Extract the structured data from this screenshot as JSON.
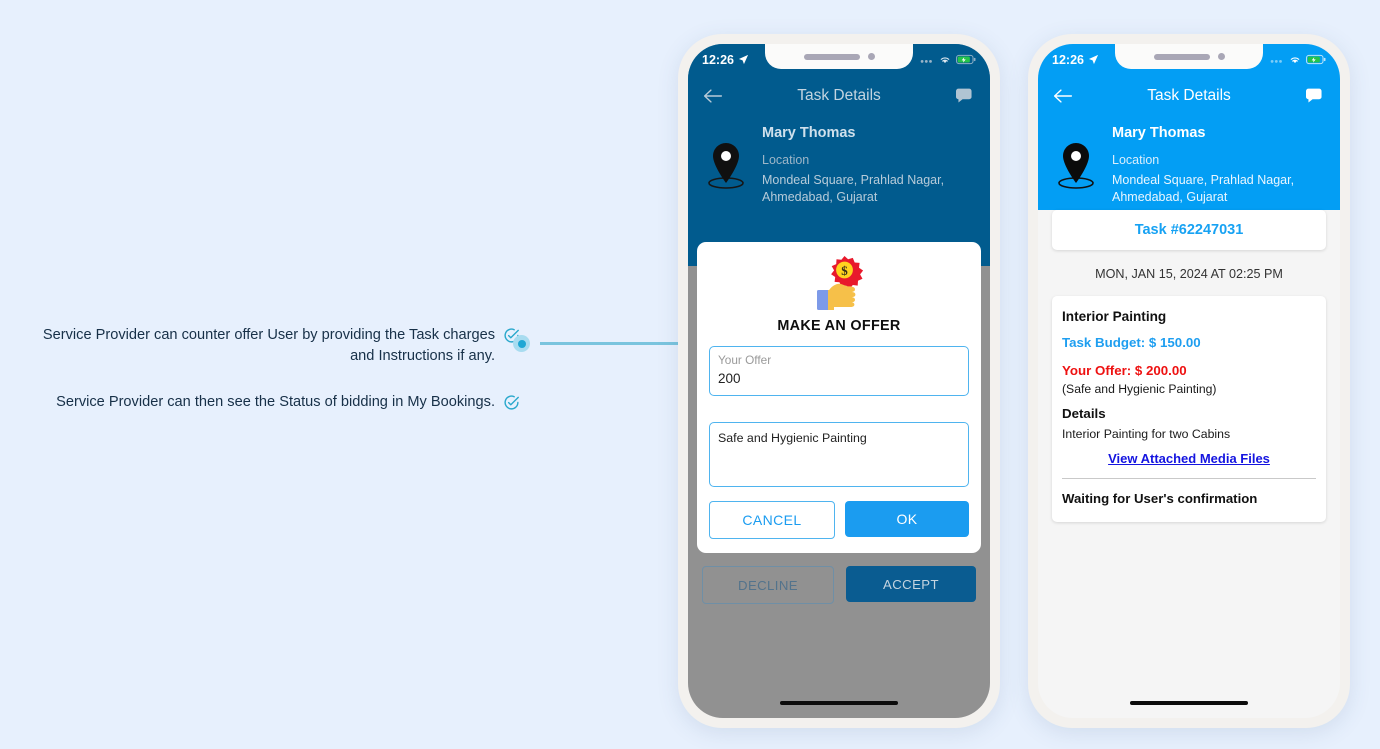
{
  "page": {
    "background_color": "#e7f0fd"
  },
  "annotations": {
    "line1": "Service Provider can counter offer User by providing the Task charges and Instructions if any.",
    "line2": "Service Provider can then see the Status of bidding in My Bookings.",
    "check_icon": "check-circle-icon",
    "marker_icon": "connector-dot",
    "accent_color": "#7ac4de"
  },
  "phone_left": {
    "status_bar": {
      "time": "12:26",
      "location_icon": "location-arrow-icon",
      "signal_icon": "signal-dots-icon",
      "wifi_icon": "wifi-icon",
      "battery_icon": "battery-charging-icon"
    },
    "app_bar": {
      "back_icon": "back-arrow-icon",
      "title": "Task Details",
      "chat_icon": "chat-bubble-icon"
    },
    "hero": {
      "pin_icon": "map-pin-icon",
      "name": "Mary Thomas",
      "location_label": "Location",
      "address": "Mondeal Square, Prahlad Nagar, Ahmedabad, Gujarat"
    },
    "behind": {
      "decline_label": "DECLINE",
      "accept_label": "ACCEPT"
    },
    "dialog": {
      "icon": "hand-holding-dollar-badge-icon",
      "title": "MAKE AN OFFER",
      "offer_label": "Your Offer",
      "offer_value": "200",
      "instructions_value": "Safe and Hygienic Painting",
      "cancel_label": "CANCEL",
      "ok_label": "OK"
    }
  },
  "phone_right": {
    "status_bar": {
      "time": "12:26",
      "location_icon": "location-arrow-icon",
      "signal_icon": "signal-dots-icon",
      "wifi_icon": "wifi-icon",
      "battery_icon": "battery-charging-icon"
    },
    "app_bar": {
      "back_icon": "back-arrow-icon",
      "title": "Task Details",
      "chat_icon": "chat-bubble-icon"
    },
    "hero": {
      "pin_icon": "map-pin-icon",
      "name": "Mary Thomas",
      "location_label": "Location",
      "address": "Mondeal Square, Prahlad Nagar, Ahmedabad, Gujarat"
    },
    "task": {
      "id_label": "Task #62247031",
      "date": "MON, JAN 15, 2024 AT 02:25 PM",
      "title": "Interior Painting",
      "budget": "Task Budget: $ 150.00",
      "offer": "Your Offer: $ 200.00",
      "offer_note": "(Safe and Hygienic Painting)",
      "details_heading": "Details",
      "details_text": "Interior Painting for two Cabins",
      "media_link": "View Attached Media Files",
      "status": "Waiting for User's confirmation"
    },
    "colors": {
      "header_blue": "#039ef4",
      "budget_blue": "#1e9ef0",
      "offer_red": "#ee1111",
      "link_blue": "#1414e0"
    }
  }
}
